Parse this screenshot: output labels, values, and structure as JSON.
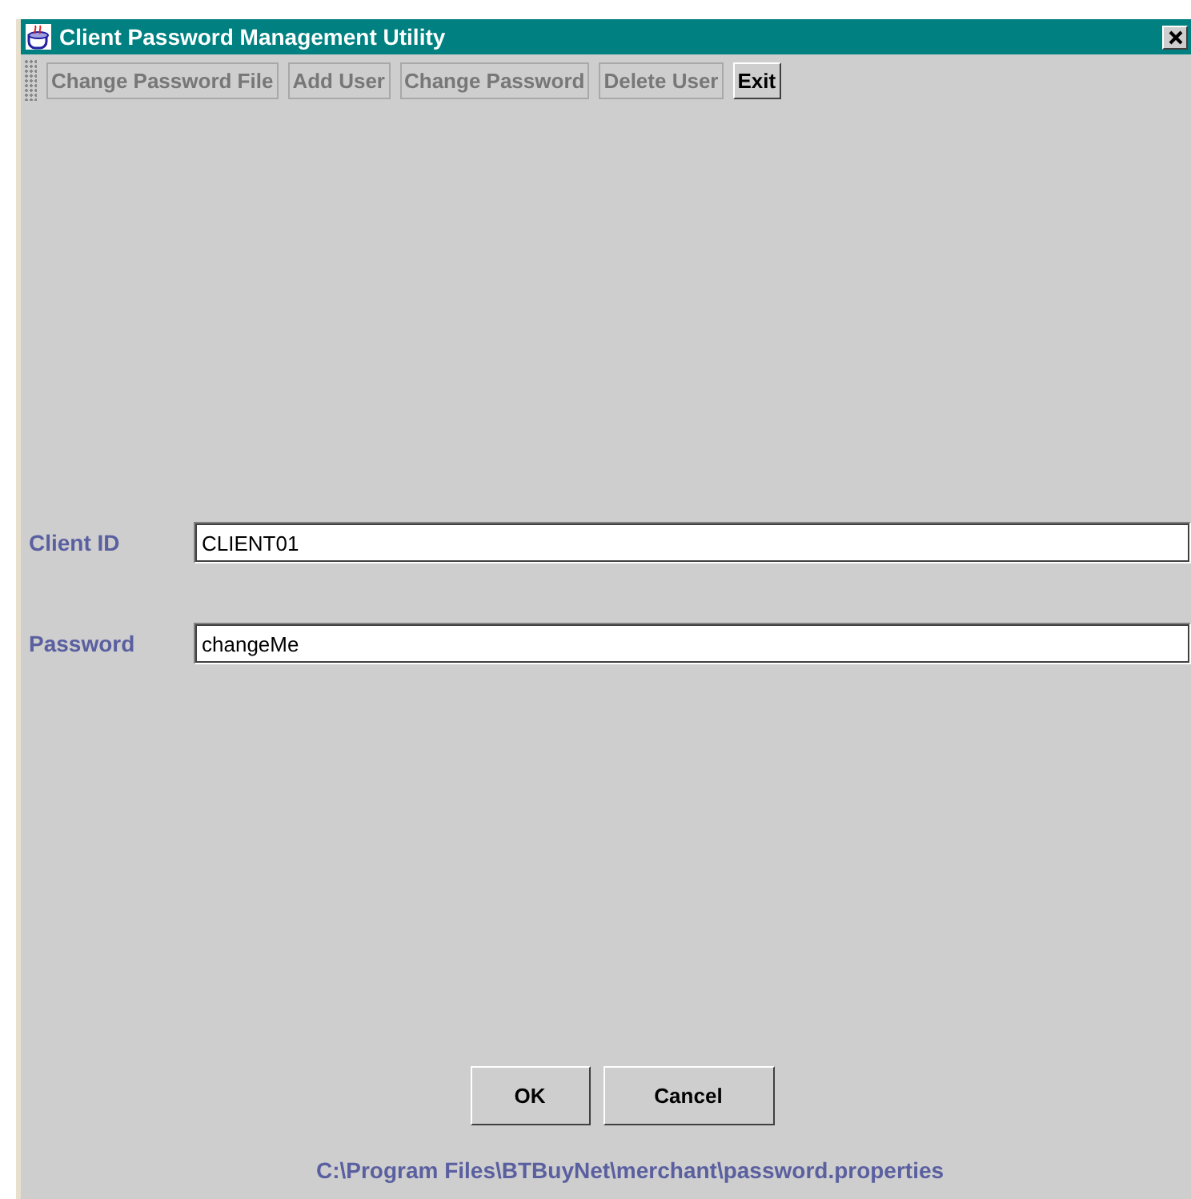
{
  "window": {
    "title": "Client Password Management Utility"
  },
  "toolbar": [
    {
      "label": "Change Password File",
      "disabled": true
    },
    {
      "label": "Add User",
      "disabled": true
    },
    {
      "label": "Change Password",
      "disabled": true
    },
    {
      "label": "Delete User",
      "disabled": true
    },
    {
      "label": "Exit",
      "disabled": false
    }
  ],
  "fields": [
    {
      "label": "Client ID",
      "value": "CLIENT01"
    },
    {
      "label": "Password",
      "value": "changeMe"
    }
  ],
  "buttons": [
    "OK",
    "Cancel"
  ],
  "status": "C:\\Program Files\\BTBuyNet\\merchant\\password.properties"
}
